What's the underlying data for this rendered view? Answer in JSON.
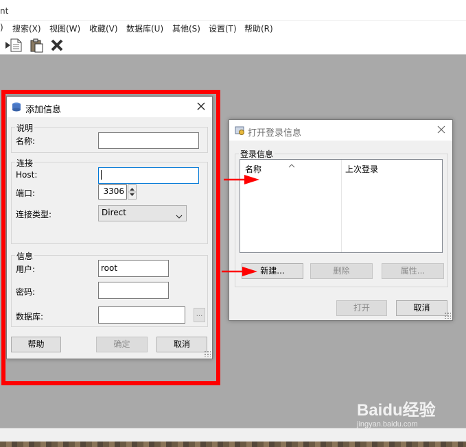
{
  "window": {
    "title_fragment": "nt"
  },
  "menu": {
    "items": [
      {
        "label": ")"
      },
      {
        "label": "搜索(X)"
      },
      {
        "label": "视图(W)"
      },
      {
        "label": "收藏(V)"
      },
      {
        "label": "数据库(U)"
      },
      {
        "label": "其他(S)"
      },
      {
        "label": "设置(T)"
      },
      {
        "label": "帮助(R)"
      }
    ]
  },
  "toolbar": {
    "icons": [
      "arrow-icon",
      "document-icon",
      "paste-icon",
      "delete-x-icon"
    ]
  },
  "add_dialog": {
    "title": "添加信息",
    "description_group": {
      "label": "说明",
      "name_label": "名称:",
      "name_value": ""
    },
    "connection_group": {
      "label": "连接",
      "host_label": "Host:",
      "host_value": "",
      "port_label": "端口:",
      "port_value": "3306",
      "type_label": "连接类型:",
      "type_selected": "Direct"
    },
    "info_group": {
      "label": "信息",
      "user_label": "用户:",
      "user_value": "root",
      "password_label": "密码:",
      "password_value": "",
      "database_label": "数据库:",
      "database_value": "",
      "browse_label": "..."
    },
    "buttons": {
      "help": "帮助",
      "ok": "确定",
      "cancel": "取消"
    }
  },
  "open_dialog": {
    "title": "打开登录信息",
    "group_label": "登录信息",
    "columns": [
      "名称",
      "上次登录"
    ],
    "rows": [],
    "buttons": {
      "new": "新建...",
      "delete": "删除",
      "properties": "属性...",
      "open": "打开",
      "cancel": "取消"
    }
  },
  "watermark": {
    "brand": "Baidu经验",
    "url": "jingyan.baidu.com"
  },
  "colors": {
    "annotation": "#ff0000",
    "focus_border": "#0078d7"
  }
}
